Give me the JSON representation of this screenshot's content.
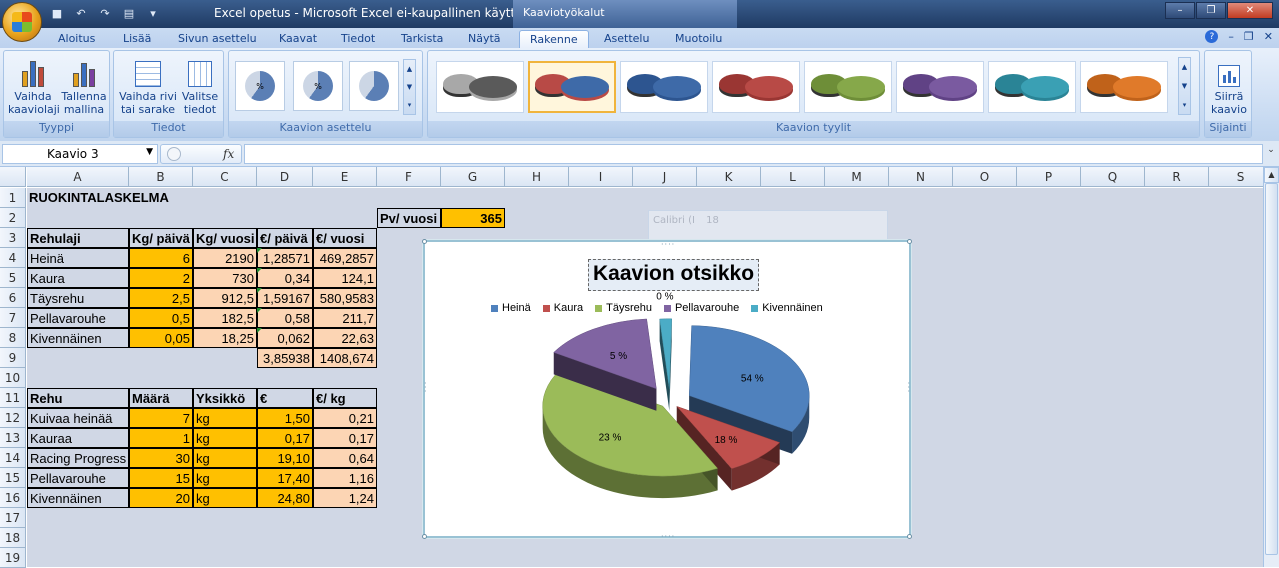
{
  "app": {
    "title": "Excel opetus - Microsoft Excel ei-kaupallinen käyttö",
    "context_tab": "Kaaviotyökalut",
    "window_buttons": [
      "–",
      "❐",
      "✕"
    ]
  },
  "tabs": [
    "Aloitus",
    "Lisää",
    "Sivun asettelu",
    "Kaavat",
    "Tiedot",
    "Tarkista",
    "Näytä",
    "Rakenne",
    "Asettelu",
    "Muotoilu"
  ],
  "active_tab": "Rakenne",
  "ribbon": {
    "groups": {
      "tyyppi": "Tyyppi",
      "tiedot": "Tiedot",
      "asettelu": "Kaavion asettelu",
      "tyylit": "Kaavion tyylit",
      "sijainti": "Sijainti"
    },
    "buttons": {
      "vaihda_kaaviolaji": [
        "Vaihda",
        "kaaviolaji"
      ],
      "tallenna_mallina": [
        "Tallenna",
        "mallina"
      ],
      "vaihda_rivi": [
        "Vaihda rivi",
        "tai sarake"
      ],
      "valitse_tiedot": [
        "Valitse",
        "tiedot"
      ],
      "siirra_kaavio": [
        "Siirrä",
        "kaavio"
      ]
    },
    "layout_labels": [
      "%",
      "%",
      ""
    ],
    "style_colors": [
      [
        "#5a5a5a",
        "#a8a8a8"
      ],
      [
        "#3e6aa8",
        "#b84a46"
      ],
      [
        "#3e6aa8",
        "#2d5590"
      ],
      [
        "#b84a46",
        "#9a3633"
      ],
      [
        "#86a84a",
        "#6e8e38"
      ],
      [
        "#7a5aa0",
        "#604285"
      ],
      [
        "#3aa0b4",
        "#2a8496"
      ],
      [
        "#e07a2a",
        "#c0621a"
      ]
    ]
  },
  "formula_bar": {
    "name_box": "Kaavio 3",
    "fx": "fx",
    "formula": ""
  },
  "columns": [
    "A",
    "B",
    "C",
    "D",
    "E",
    "F",
    "G",
    "H",
    "I",
    "J",
    "K",
    "L",
    "M",
    "N",
    "O",
    "P",
    "Q",
    "R",
    "S"
  ],
  "rows": [
    "1",
    "2",
    "3",
    "4",
    "5",
    "6",
    "7",
    "8",
    "9",
    "10",
    "11",
    "12",
    "13",
    "14",
    "15",
    "16",
    "17",
    "18",
    "19"
  ],
  "sheet": {
    "a1": "RUOKINTALASKELMA",
    "pv_label": "Pv/ vuosi",
    "pv_value": "365",
    "table1": {
      "headers": [
        "Rehulaji",
        "Kg/ päivä",
        "Kg/ vuosi",
        "€/ päivä",
        "€/ vuosi"
      ],
      "rows": [
        [
          "Heinä",
          "6",
          "2190",
          "1,28571",
          "469,2857"
        ],
        [
          "Kaura",
          "2",
          "730",
          "0,34",
          "124,1"
        ],
        [
          "Täysrehu",
          "2,5",
          "912,5",
          "1,59167",
          "580,9583"
        ],
        [
          "Pellavarouhe",
          "0,5",
          "182,5",
          "0,58",
          "211,7"
        ],
        [
          "Kivennäinen",
          "0,05",
          "18,25",
          "0,062",
          "22,63"
        ]
      ],
      "totals": [
        "3,85938",
        "1408,674"
      ]
    },
    "table2": {
      "headers": [
        "Rehu",
        "Määrä",
        "Yksikkö",
        "€",
        "€/ kg"
      ],
      "rows": [
        [
          "Kuivaa heinää",
          "7",
          "kg",
          "1,50",
          "0,21"
        ],
        [
          "Kauraa",
          "1",
          "kg",
          "0,17",
          "0,17"
        ],
        [
          "Racing Progress",
          "30",
          "kg",
          "19,10",
          "0,64"
        ],
        [
          "Pellavarouhe",
          "15",
          "kg",
          "17,40",
          "1,16"
        ],
        [
          "Kivennäinen",
          "20",
          "kg",
          "24,80",
          "1,24"
        ]
      ]
    }
  },
  "mini_toolbar": {
    "font": "Calibri (I",
    "size": "18"
  },
  "chart_data": {
    "type": "pie",
    "title": "Kaavion otsikko",
    "categories": [
      "Heinä",
      "Kaura",
      "Täysrehu",
      "Pellavarouhe",
      "Kivennäinen"
    ],
    "values": [
      469.2857,
      124.1,
      580.9583,
      211.7,
      22.63
    ],
    "data_labels": [
      "54 %",
      "18 %",
      "23 %",
      "5 %",
      "0 %"
    ],
    "colors": [
      "#4f81bd",
      "#c0504d",
      "#9bbb59",
      "#8064a2",
      "#4bacc6"
    ],
    "legend_position": "top",
    "exploded": true
  }
}
